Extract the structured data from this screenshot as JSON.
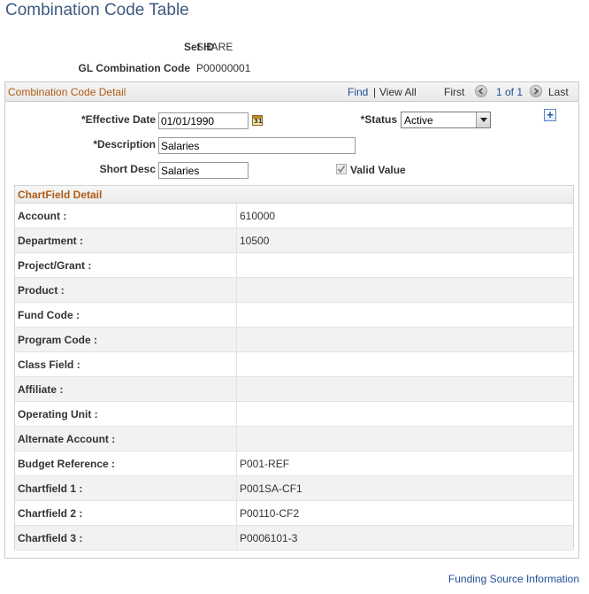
{
  "page": {
    "title": "Combination Code Table"
  },
  "header": {
    "setid_label": "Set ID",
    "setid_value": "SHARE",
    "glcode_label": "GL Combination Code",
    "glcode_value": "P00000001"
  },
  "detail": {
    "title": "Combination Code Detail",
    "find": "Find",
    "separator": "|",
    "view_all": "View All",
    "first": "First",
    "count": "1 of 1",
    "last": "Last",
    "effective_date_label": "*Effective Date",
    "effective_date_value": "01/01/1990",
    "calendar_icon_text": "31",
    "status_label": "*Status",
    "status_value": "Active",
    "description_label": "*Description",
    "description_value": "Salaries",
    "short_desc_label": "Short Desc",
    "short_desc_value": "Salaries",
    "valid_value_label": "Valid Value",
    "valid_value_checked": true,
    "add_button": "+"
  },
  "chartfield": {
    "title": "ChartField Detail",
    "rows": [
      {
        "label": "Account :",
        "value": "610000"
      },
      {
        "label": "Department :",
        "value": "10500"
      },
      {
        "label": "Project/Grant :",
        "value": ""
      },
      {
        "label": "Product :",
        "value": ""
      },
      {
        "label": "Fund Code :",
        "value": ""
      },
      {
        "label": "Program Code :",
        "value": ""
      },
      {
        "label": "Class Field :",
        "value": ""
      },
      {
        "label": "Affiliate :",
        "value": ""
      },
      {
        "label": "Operating Unit :",
        "value": ""
      },
      {
        "label": "Alternate Account :",
        "value": ""
      },
      {
        "label": "Budget Reference :",
        "value": "P001-REF"
      },
      {
        "label": "Chartfield 1 :",
        "value": "P001SA-CF1"
      },
      {
        "label": "Chartfield 2 :",
        "value": "P00110-CF2"
      },
      {
        "label": "Chartfield 3 :",
        "value": "P0006101-3"
      }
    ]
  },
  "footer": {
    "link": "Funding Source Information"
  },
  "colors": {
    "title": "#3d5a80",
    "section_title": "#b05b14",
    "link": "#1f4d99"
  },
  "icons": [
    "calendar-icon",
    "previous-icon",
    "next-icon",
    "dropdown-arrow-icon",
    "add-row-icon",
    "checkbox-icon"
  ]
}
